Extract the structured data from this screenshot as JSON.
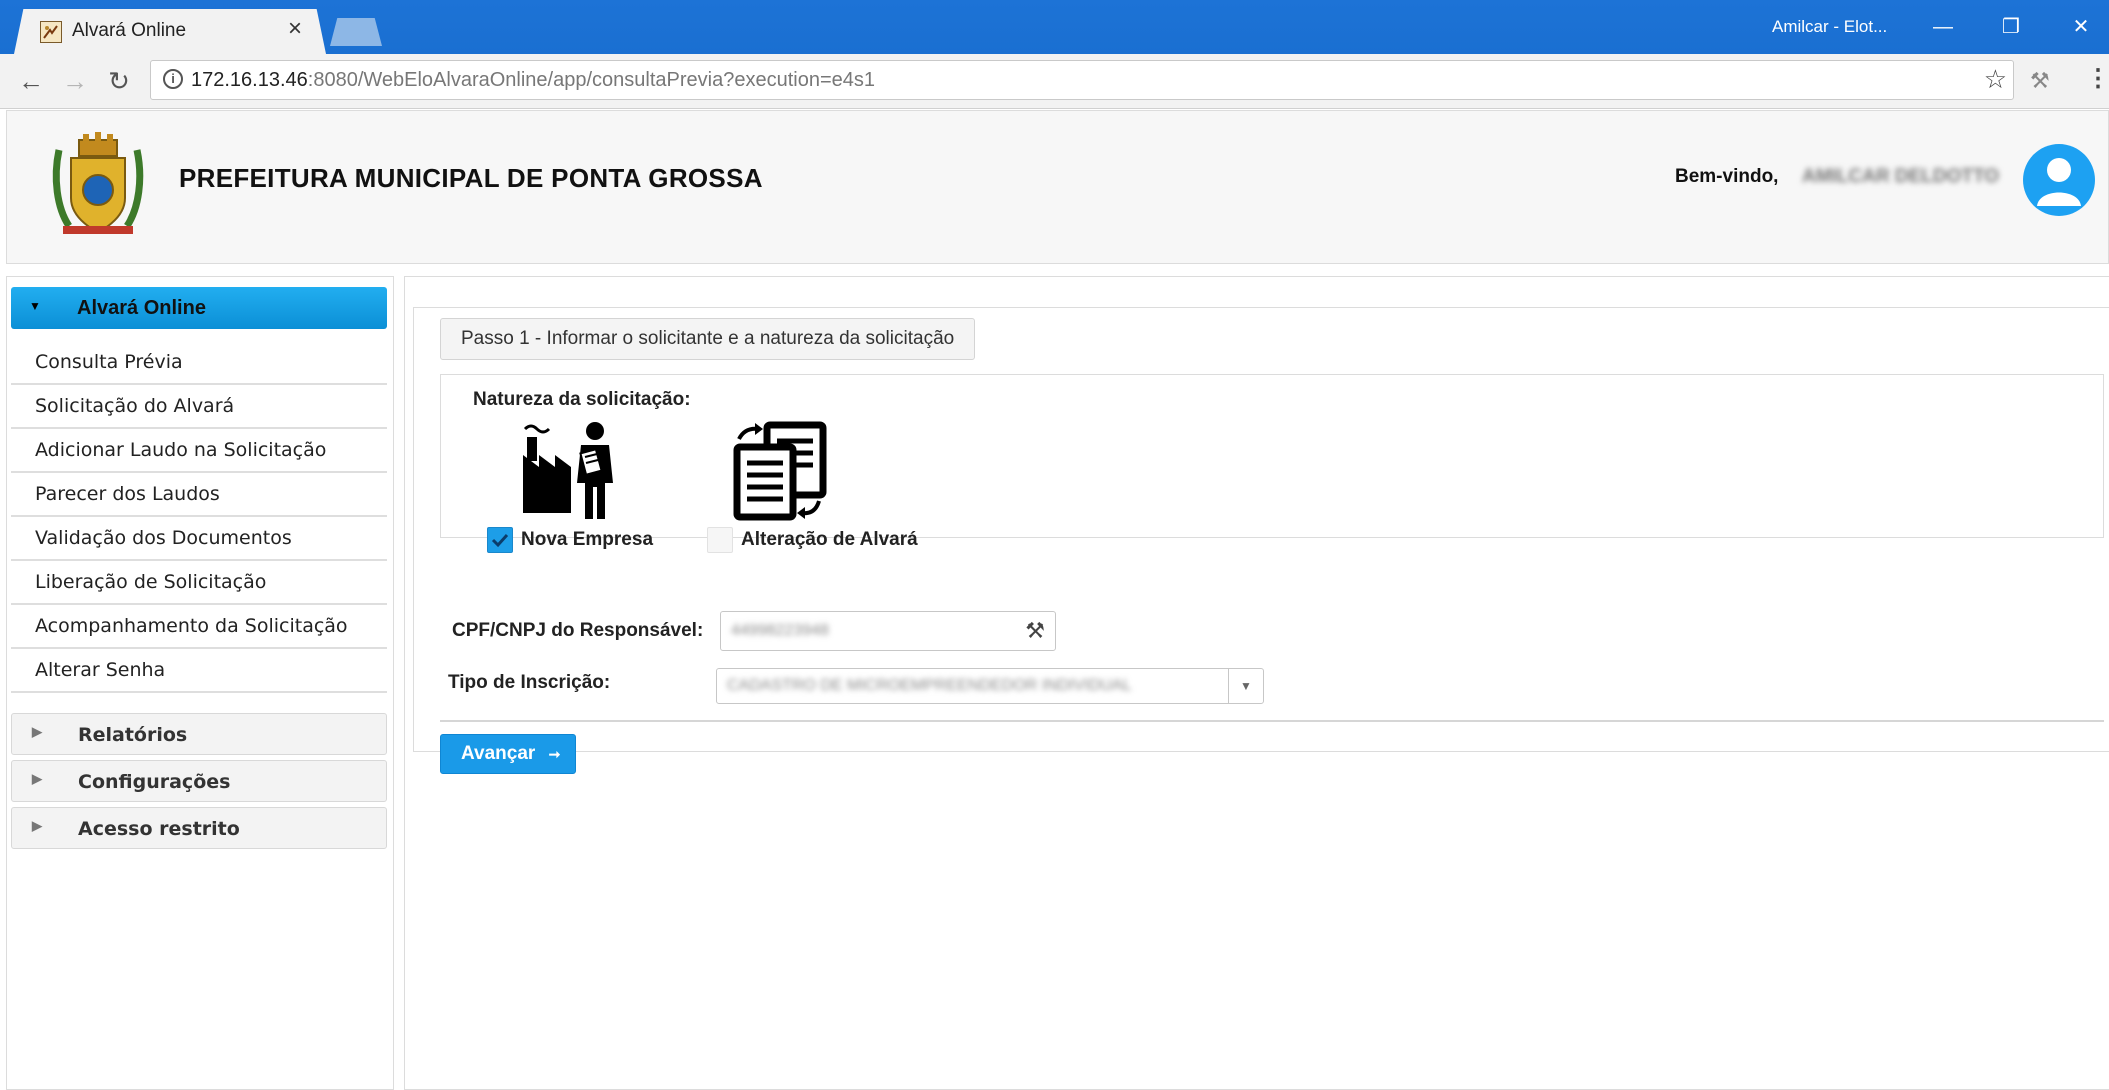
{
  "browser": {
    "tab_title": "Alvará Online",
    "tab_close": "×",
    "window_user": "Amilcar - Elot...",
    "url_host": "172.16.13.46",
    "url_rest": ":8080/WebEloAlvaraOnline/app/consultaPrevia?execution=e4s1",
    "controls": {
      "minimize": "—",
      "restore": "❐",
      "close": "✕"
    },
    "nav": {
      "back": "←",
      "forward": "→",
      "reload": "↻"
    },
    "info_symbol": "i",
    "bookmark_symbol": "☆",
    "extension_symbol": "⚒",
    "menu_symbol": "⋮"
  },
  "header": {
    "org_name": "PREFEITURA MUNICIPAL DE PONTA GROSSA",
    "welcome": "Bem-vindo,",
    "user_name": "AMILCAR DELDOTTO"
  },
  "sidebar": {
    "active_section": "Alvará Online",
    "items": [
      {
        "label": "Consulta Prévia"
      },
      {
        "label": "Solicitação do Alvará"
      },
      {
        "label": "Adicionar Laudo na Solicitação"
      },
      {
        "label": "Parecer dos Laudos"
      },
      {
        "label": "Validação dos Documentos"
      },
      {
        "label": "Liberação de Solicitação"
      },
      {
        "label": "Acompanhamento da Solicitação"
      },
      {
        "label": "Alterar Senha"
      }
    ],
    "sections": [
      {
        "label": "Relatórios"
      },
      {
        "label": "Configurações"
      },
      {
        "label": "Acesso restrito"
      }
    ],
    "caret_open": "▼",
    "caret_closed": "▶"
  },
  "form": {
    "step_title": "Passo 1 - Informar o solicitante e a natureza da solicitação",
    "nature_label": "Natureza da solicitação:",
    "option_new": "Nova Empresa",
    "option_new_checked": true,
    "option_change": "Alteração de Alvará",
    "option_change_checked": false,
    "cpf_label": "CPF/CNPJ do Responsável:",
    "cpf_value": "44998223948",
    "tipo_label": "Tipo de Inscrição:",
    "tipo_value": "CADASTRO DE MICROEMPREENDEDOR INDIVIDUAL",
    "next_button": "Avançar",
    "next_arrow": "➞"
  },
  "colors": {
    "chrome_blue": "#1d73d6",
    "accent_blue": "#1a9ae8",
    "active_menu": "#0b8fd6"
  }
}
